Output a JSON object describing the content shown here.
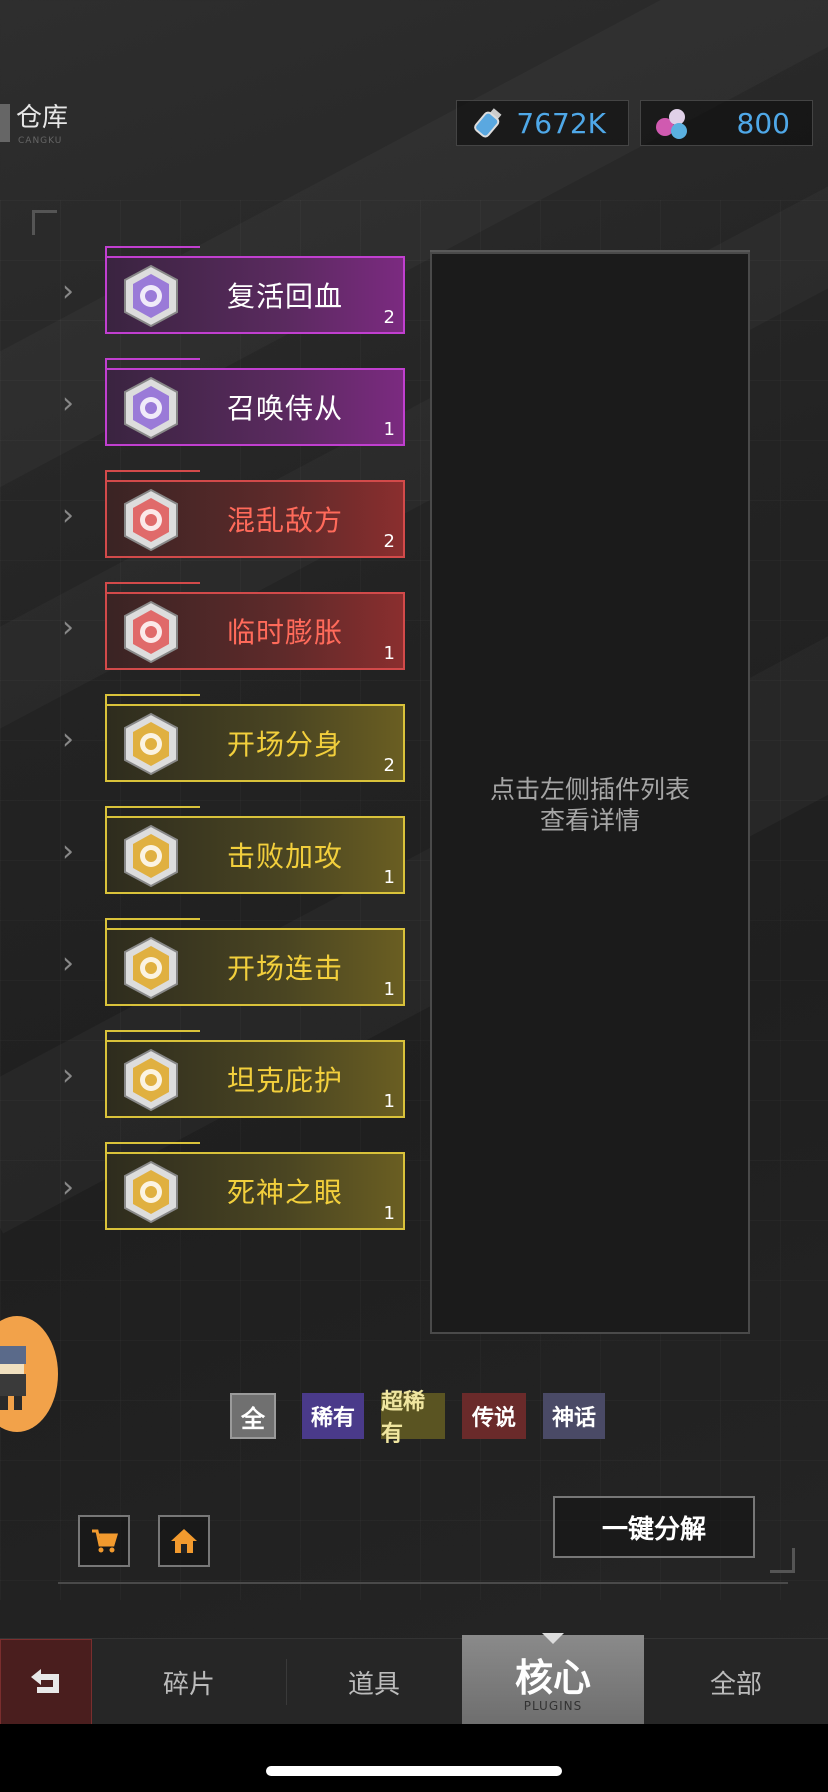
{
  "header": {
    "title": "仓库",
    "subtitle": "CANGKU"
  },
  "currencies": [
    {
      "icon": "energy-bottle-icon",
      "value": "7672K"
    },
    {
      "icon": "gem-cluster-icon",
      "value": "800"
    }
  ],
  "plugins": [
    {
      "name": "复活回血",
      "count": "2",
      "rarity": "purple",
      "icon": "revive-emblem-icon"
    },
    {
      "name": "召唤侍从",
      "count": "1",
      "rarity": "purple",
      "icon": "summon-emblem-icon"
    },
    {
      "name": "混乱敌方",
      "count": "2",
      "rarity": "red",
      "icon": "chaos-emblem-icon"
    },
    {
      "name": "临时膨胀",
      "count": "1",
      "rarity": "red",
      "icon": "inflate-emblem-icon"
    },
    {
      "name": "开场分身",
      "count": "2",
      "rarity": "gold",
      "icon": "clone-emblem-icon"
    },
    {
      "name": "击败加攻",
      "count": "1",
      "rarity": "gold",
      "icon": "attack-emblem-icon"
    },
    {
      "name": "开场连击",
      "count": "1",
      "rarity": "gold",
      "icon": "combo-emblem-icon"
    },
    {
      "name": "坦克庇护",
      "count": "1",
      "rarity": "gold",
      "icon": "tank-emblem-icon"
    },
    {
      "name": "死神之眼",
      "count": "1",
      "rarity": "gold",
      "icon": "reaper-emblem-icon"
    }
  ],
  "detail": {
    "line1": "点击左侧插件列表",
    "line2": "查看详情"
  },
  "filters": {
    "all": "全",
    "rare": "稀有",
    "super_rare": "超稀有",
    "legend": "传说",
    "myth": "神话"
  },
  "actions": {
    "decompose": "一键分解"
  },
  "nav": {
    "fragments": "碎片",
    "items": "道具",
    "core": "核心",
    "core_en": "PLUGINS",
    "all": "全部"
  },
  "colors": {
    "purple": "#c13fd0",
    "red": "#d24a4a",
    "gold": "#d9c23a",
    "currency": "#4fa8e8"
  }
}
